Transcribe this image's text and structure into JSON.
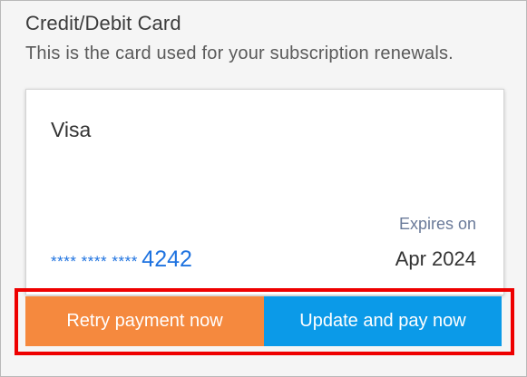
{
  "section": {
    "title": "Credit/Debit Card",
    "description": "This is the card used for your subscription renewals."
  },
  "card": {
    "brand": "Visa",
    "masked_number": "**** **** ****",
    "last4": "4242",
    "expires_label": "Expires on",
    "expires_value": "Apr 2024"
  },
  "actions": {
    "retry_label": "Retry payment now",
    "update_label": "Update and pay now"
  },
  "colors": {
    "retry_button": "#f5893e",
    "update_button": "#0b9ae8",
    "card_number": "#1f73e0",
    "highlight_border": "#ee0000"
  }
}
